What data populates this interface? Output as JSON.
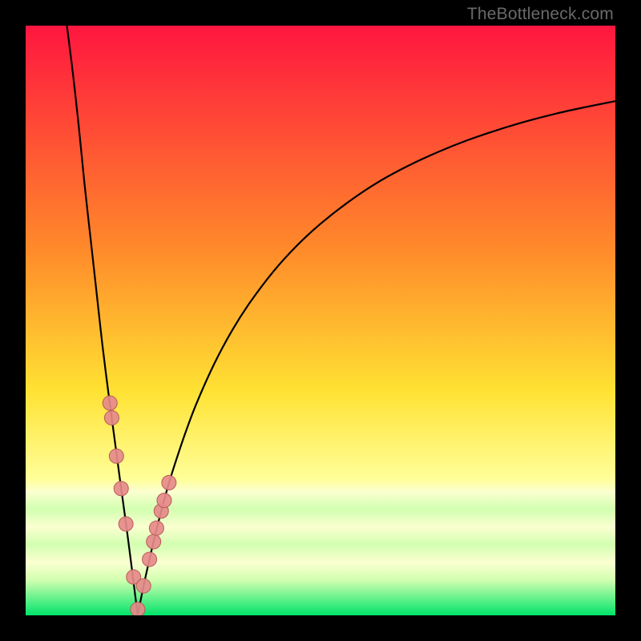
{
  "watermark": "TheBottleneck.com",
  "colors": {
    "frame": "#000000",
    "curve": "#000000",
    "marker_fill": "#e68a8a",
    "marker_stroke": "#b85a5a",
    "gradient_top": "#ff163f",
    "gradient_orange": "#ff8a2a",
    "gradient_yellow": "#ffe233",
    "gradient_paleyellow": "#ffff9a",
    "gradient_band_a": "#fbffd0",
    "gradient_band_b": "#d2ffb0",
    "gradient_green": "#00e46a"
  },
  "chart_data": {
    "type": "line",
    "title": "",
    "xlabel": "",
    "ylabel": "",
    "xlim": [
      0,
      100
    ],
    "ylim": [
      0,
      100
    ],
    "x_minimum": 19,
    "series": [
      {
        "name": "left-branch",
        "x": [
          7,
          8,
          9,
          10,
          11,
          12,
          13,
          14,
          15,
          16,
          17,
          18,
          19
        ],
        "y": [
          100,
          92,
          83,
          73,
          64,
          55,
          46,
          38,
          30.5,
          23,
          15.7,
          8,
          0
        ]
      },
      {
        "name": "right-branch",
        "x": [
          19,
          20,
          21,
          22,
          23,
          24,
          25,
          27,
          29,
          32,
          35,
          38,
          42,
          46,
          50,
          55,
          60,
          65,
          70,
          75,
          80,
          85,
          90,
          95,
          100
        ],
        "y": [
          0,
          5,
          9.5,
          13.8,
          17.7,
          21.4,
          24.7,
          30.7,
          36,
          42.7,
          48.3,
          53,
          58.3,
          62.7,
          66.4,
          70.3,
          73.6,
          76.3,
          78.6,
          80.6,
          82.3,
          83.8,
          85.1,
          86.2,
          87.2
        ]
      }
    ],
    "markers": {
      "name": "highlighted-points",
      "x": [
        14.3,
        14.6,
        15.4,
        16.2,
        17.0,
        18.3,
        19.0,
        20.0,
        21.0,
        21.7,
        22.2,
        23.0,
        23.5,
        24.3
      ],
      "y": [
        36.0,
        33.5,
        27.0,
        21.5,
        15.5,
        6.5,
        1.0,
        5.0,
        9.5,
        12.5,
        14.8,
        17.7,
        19.5,
        22.5
      ]
    }
  }
}
